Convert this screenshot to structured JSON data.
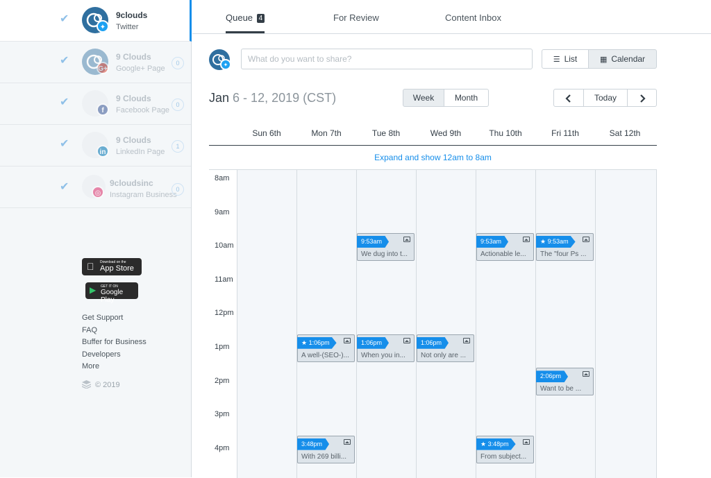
{
  "profiles": [
    {
      "name": "9clouds",
      "type": "Twitter",
      "network": "twitter",
      "badge": "",
      "count": ""
    },
    {
      "name": "9 Clouds",
      "type": "Google+ Page",
      "network": "google-plus",
      "badge": "G+",
      "count": "0"
    },
    {
      "name": "9 Clouds",
      "type": "Facebook Page",
      "network": "facebook",
      "badge": "f",
      "count": "0"
    },
    {
      "name": "9 Clouds",
      "type": "LinkedIn Page",
      "network": "linkedin",
      "badge": "in",
      "count": "1"
    },
    {
      "name": "9cloudsinc",
      "type": "Instagram Business",
      "network": "instagram",
      "badge": "◎",
      "count": "0"
    }
  ],
  "stores": {
    "app_store_small": "Download on the",
    "app_store": "App Store",
    "google_play_small": "GET IT ON",
    "google_play": "Google Play"
  },
  "footer": {
    "links": [
      "Get Support",
      "FAQ",
      "Buffer for Business",
      "Developers",
      "More"
    ],
    "copyright": "© 2019"
  },
  "tabs": {
    "queue": "Queue",
    "queue_count": "4",
    "review": "For Review",
    "inbox": "Content Inbox"
  },
  "composer": {
    "placeholder": "What do you want to share?"
  },
  "view_toggle": {
    "list": "List",
    "calendar": "Calendar",
    "selected": "Calendar"
  },
  "date_range": {
    "month": "Jan",
    "range": "6 - 12, 2019 (CST)"
  },
  "period_toggle": {
    "week": "Week",
    "month": "Month",
    "selected": "Week"
  },
  "nav": {
    "today": "Today",
    "prev_icon": "chevron-left-icon",
    "next_icon": "chevron-right-icon"
  },
  "days": [
    "Sun 6th",
    "Mon 7th",
    "Tue 8th",
    "Wed 9th",
    "Thu 10th",
    "Fri 11th",
    "Sat 12th"
  ],
  "expand_label": "Expand and show 12am to 8am",
  "hours": [
    "8am",
    "9am",
    "10am",
    "11am",
    "12pm",
    "1pm",
    "2pm",
    "3pm",
    "4pm"
  ],
  "posts": [
    {
      "day": 2,
      "hour": 2,
      "time": "9:53am",
      "starred": false,
      "text": "We dug into t..."
    },
    {
      "day": 4,
      "hour": 2,
      "time": "9:53am",
      "starred": false,
      "text": "Actionable le..."
    },
    {
      "day": 5,
      "hour": 2,
      "time": "9:53am",
      "starred": true,
      "text": "The \"four Ps ..."
    },
    {
      "day": 1,
      "hour": 5,
      "time": "1:06pm",
      "starred": true,
      "text": "A well-(SEO-)..."
    },
    {
      "day": 2,
      "hour": 5,
      "time": "1:06pm",
      "starred": false,
      "text": "When you in..."
    },
    {
      "day": 3,
      "hour": 5,
      "time": "1:06pm",
      "starred": false,
      "text": "Not only are ..."
    },
    {
      "day": 5,
      "hour": 6,
      "time": "2:06pm",
      "starred": false,
      "text": "Want to be ..."
    },
    {
      "day": 1,
      "hour": 8,
      "time": "3:48pm",
      "starred": false,
      "text": "With 269 billi..."
    },
    {
      "day": 4,
      "hour": 8,
      "time": "3:48pm",
      "starred": true,
      "text": "From subject..."
    }
  ],
  "colors": {
    "accent": "#168eea",
    "twitter": "#1da1f2",
    "google": "#dd4b39",
    "facebook": "#3b5998",
    "linkedin": "#0077b5",
    "instagram": "#e1306c"
  }
}
